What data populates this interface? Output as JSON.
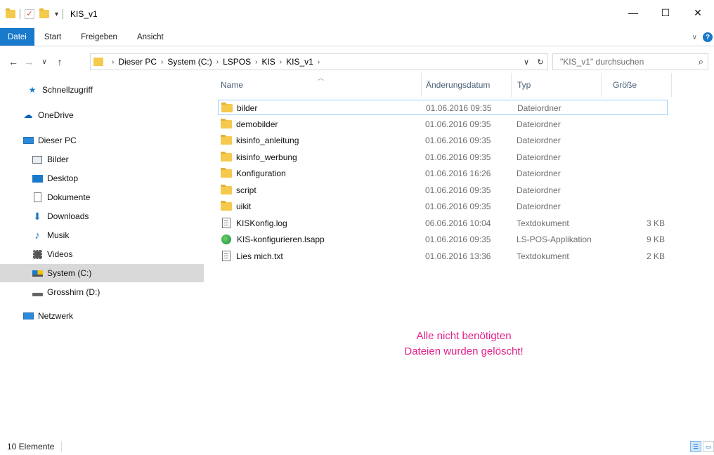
{
  "window": {
    "title": "KIS_v1",
    "controls": {
      "minimize": "—",
      "maximize": "☐",
      "close": "✕"
    }
  },
  "ribbon": {
    "tabs": [
      "Datei",
      "Start",
      "Freigeben",
      "Ansicht"
    ],
    "file_tab_color": "#1979ca"
  },
  "address": {
    "breadcrumb": [
      "Dieser PC",
      "System (C:)",
      "LSPOS",
      "KIS",
      "KIS_v1"
    ],
    "search_placeholder": "\"KIS_v1\" durchsuchen"
  },
  "sidebar": {
    "items": [
      {
        "label": "Schnellzugriff",
        "icon": "star-icon"
      },
      {
        "label": "OneDrive",
        "icon": "cloud-icon"
      },
      {
        "label": "Dieser PC",
        "icon": "computer-icon"
      },
      {
        "label": "Bilder",
        "icon": "pictures-icon"
      },
      {
        "label": "Desktop",
        "icon": "desktop-icon"
      },
      {
        "label": "Dokumente",
        "icon": "documents-icon"
      },
      {
        "label": "Downloads",
        "icon": "download-arrow-icon"
      },
      {
        "label": "Musik",
        "icon": "music-note-icon"
      },
      {
        "label": "Videos",
        "icon": "film-icon"
      },
      {
        "label": "System (C:)",
        "icon": "system-drive-icon",
        "selected": true
      },
      {
        "label": "Grosshirn (D:)",
        "icon": "drive-icon"
      },
      {
        "label": "Netzwerk",
        "icon": "network-icon"
      }
    ]
  },
  "columns": {
    "name": "Name",
    "date": "Änderungsdatum",
    "type": "Typ",
    "size": "Größe"
  },
  "files": [
    {
      "name": "bilder",
      "date": "01.06.2016 09:35",
      "type": "Dateiordner",
      "size": "",
      "icon": "folder-icon",
      "selected": true
    },
    {
      "name": "demobilder",
      "date": "01.06.2016 09:35",
      "type": "Dateiordner",
      "size": "",
      "icon": "folder-icon"
    },
    {
      "name": "kisinfo_anleitung",
      "date": "01.06.2016 09:35",
      "type": "Dateiordner",
      "size": "",
      "icon": "folder-icon"
    },
    {
      "name": "kisinfo_werbung",
      "date": "01.06.2016 09:35",
      "type": "Dateiordner",
      "size": "",
      "icon": "folder-icon"
    },
    {
      "name": "Konfiguration",
      "date": "01.06.2016 16:26",
      "type": "Dateiordner",
      "size": "",
      "icon": "folder-icon"
    },
    {
      "name": "script",
      "date": "01.06.2016 09:35",
      "type": "Dateiordner",
      "size": "",
      "icon": "folder-icon"
    },
    {
      "name": "uikit",
      "date": "01.06.2016 09:35",
      "type": "Dateiordner",
      "size": "",
      "icon": "folder-icon"
    },
    {
      "name": "KISKonfig.log",
      "date": "06.06.2016 10:04",
      "type": "Textdokument",
      "size": "3 KB",
      "icon": "text-document-icon"
    },
    {
      "name": "KIS-konfigurieren.lsapp",
      "date": "01.06.2016 09:35",
      "type": "LS-POS-Applikation",
      "size": "9 KB",
      "icon": "globe-app-icon"
    },
    {
      "name": "Lies mich.txt",
      "date": "01.06.2016 13:36",
      "type": "Textdokument",
      "size": "2 KB",
      "icon": "text-document-icon"
    }
  ],
  "annotation": {
    "line1": "Alle nicht benötigten",
    "line2": "Dateien wurden gelöscht!",
    "color": "#e1218a"
  },
  "status": {
    "item_count": "10 Elemente"
  }
}
